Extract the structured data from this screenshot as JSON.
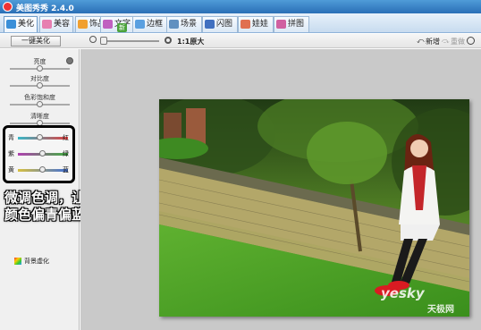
{
  "window": {
    "title": "美图秀秀 2.4.0"
  },
  "tabs": [
    {
      "label": "美化",
      "color": "#3a8fd8",
      "active": true
    },
    {
      "label": "美容",
      "color": "#e77fb0"
    },
    {
      "label": "饰品",
      "color": "#f0a030"
    },
    {
      "label": "文字",
      "color": "#c060c0",
      "badge": "新"
    },
    {
      "label": "边框",
      "color": "#5aa0e0"
    },
    {
      "label": "场景",
      "color": "#6090c0"
    },
    {
      "label": "闪图",
      "color": "#4070c0"
    },
    {
      "label": "娃娃",
      "color": "#e07050"
    },
    {
      "label": "拼图",
      "color": "#d060a0"
    }
  ],
  "toolbar": {
    "one_click": "一键美化",
    "zoom_ratio": "1:1原大",
    "new_label": "新增",
    "redo_label": "重做",
    "undo_label": "撤消",
    "zoom_level": 0
  },
  "adjust": [
    {
      "label": "亮度",
      "value": 0.5
    },
    {
      "label": "对比度",
      "value": 0.5
    },
    {
      "label": "色彩饱和度",
      "value": 0.5
    },
    {
      "label": "清晰度",
      "value": 0.5
    }
  ],
  "color_balance": [
    {
      "left": "青",
      "right": "红",
      "value": 0.45,
      "colors": [
        "#38b8c8",
        "#e04040"
      ]
    },
    {
      "left": "紫",
      "right": "绿",
      "value": 0.5,
      "colors": [
        "#b040b0",
        "#40b040"
      ]
    },
    {
      "left": "黄",
      "right": "蓝",
      "value": 0.5,
      "colors": [
        "#d8c040",
        "#4070d8"
      ]
    }
  ],
  "effects": [
    "背景虚化"
  ],
  "caption": {
    "line1": "微调色调，让",
    "line2": "颜色偏青偏蓝。"
  },
  "watermark": {
    "brand": "yesky",
    "cn": "天极网"
  }
}
